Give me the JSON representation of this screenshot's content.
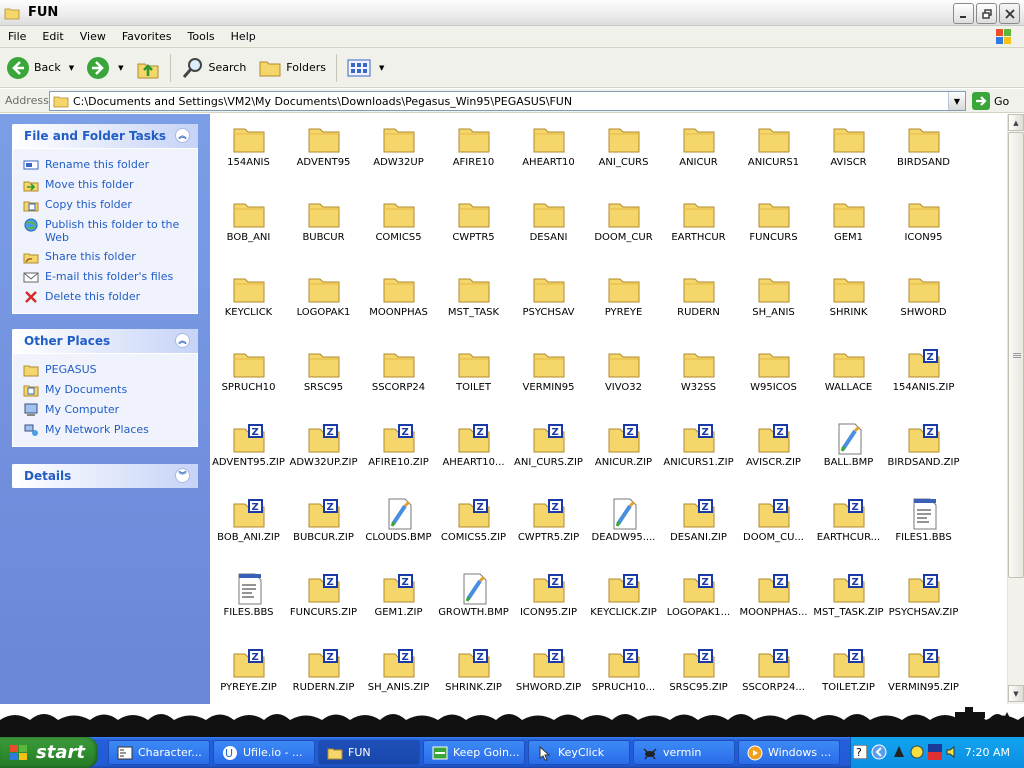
{
  "window": {
    "title": "FUN"
  },
  "menu": [
    "File",
    "Edit",
    "View",
    "Favorites",
    "Tools",
    "Help"
  ],
  "toolbar": {
    "back_label": "Back",
    "search_label": "Search",
    "folders_label": "Folders"
  },
  "address": {
    "label": "Address",
    "path": "C:\\Documents and Settings\\VM2\\My Documents\\Downloads\\Pegasus_Win95\\PEGASUS\\FUN",
    "go_label": "Go"
  },
  "tasks_panel": {
    "title": "File and Folder Tasks",
    "items": [
      {
        "label": "Rename this folder",
        "icon": "rename-icon"
      },
      {
        "label": "Move this folder",
        "icon": "move-icon"
      },
      {
        "label": "Copy this folder",
        "icon": "copy-icon"
      },
      {
        "label": "Publish this folder to the Web",
        "icon": "publish-web-icon"
      },
      {
        "label": "Share this folder",
        "icon": "share-icon"
      },
      {
        "label": "E-mail this folder's files",
        "icon": "email-icon"
      },
      {
        "label": "Delete this folder",
        "icon": "delete-icon"
      }
    ]
  },
  "places_panel": {
    "title": "Other Places",
    "items": [
      {
        "label": "PEGASUS",
        "icon": "folder-icon"
      },
      {
        "label": "My Documents",
        "icon": "my-documents-icon"
      },
      {
        "label": "My Computer",
        "icon": "my-computer-icon"
      },
      {
        "label": "My Network Places",
        "icon": "network-places-icon"
      }
    ]
  },
  "details_panel": {
    "title": "Details"
  },
  "files": [
    {
      "name": "154ANIS",
      "type": "folder"
    },
    {
      "name": "ADVENT95",
      "type": "folder"
    },
    {
      "name": "ADW32UP",
      "type": "folder"
    },
    {
      "name": "AFIRE10",
      "type": "folder"
    },
    {
      "name": "AHEART10",
      "type": "folder"
    },
    {
      "name": "ANI_CURS",
      "type": "folder"
    },
    {
      "name": "ANICUR",
      "type": "folder"
    },
    {
      "name": "ANICURS1",
      "type": "folder"
    },
    {
      "name": "AVISCR",
      "type": "folder"
    },
    {
      "name": "BIRDSAND",
      "type": "folder"
    },
    {
      "name": "BOB_ANI",
      "type": "folder"
    },
    {
      "name": "BUBCUR",
      "type": "folder"
    },
    {
      "name": "COMICS5",
      "type": "folder"
    },
    {
      "name": "CWPTR5",
      "type": "folder"
    },
    {
      "name": "DESANI",
      "type": "folder"
    },
    {
      "name": "DOOM_CUR",
      "type": "folder"
    },
    {
      "name": "EARTHCUR",
      "type": "folder"
    },
    {
      "name": "FUNCURS",
      "type": "folder"
    },
    {
      "name": "GEM1",
      "type": "folder"
    },
    {
      "name": "ICON95",
      "type": "folder"
    },
    {
      "name": "KEYCLICK",
      "type": "folder"
    },
    {
      "name": "LOGOPAK1",
      "type": "folder"
    },
    {
      "name": "MOONPHAS",
      "type": "folder"
    },
    {
      "name": "MST_TASK",
      "type": "folder"
    },
    {
      "name": "PSYCHSAV",
      "type": "folder"
    },
    {
      "name": "PYREYE",
      "type": "folder"
    },
    {
      "name": "RUDERN",
      "type": "folder"
    },
    {
      "name": "SH_ANIS",
      "type": "folder"
    },
    {
      "name": "SHRINK",
      "type": "folder"
    },
    {
      "name": "SHWORD",
      "type": "folder"
    },
    {
      "name": "SPRUCH10",
      "type": "folder"
    },
    {
      "name": "SRSC95",
      "type": "folder"
    },
    {
      "name": "SSCORP24",
      "type": "folder"
    },
    {
      "name": "TOILET",
      "type": "folder"
    },
    {
      "name": "VERMIN95",
      "type": "folder"
    },
    {
      "name": "VIVO32",
      "type": "folder"
    },
    {
      "name": "W32SS",
      "type": "folder"
    },
    {
      "name": "W95ICOS",
      "type": "folder"
    },
    {
      "name": "WALLACE",
      "type": "folder"
    },
    {
      "name": "154ANIS.ZIP",
      "type": "zip"
    },
    {
      "name": "ADVENT95.ZIP",
      "type": "zip"
    },
    {
      "name": "ADW32UP.ZIP",
      "type": "zip"
    },
    {
      "name": "AFIRE10.ZIP",
      "type": "zip"
    },
    {
      "name": "AHEART10...",
      "type": "zip"
    },
    {
      "name": "ANI_CURS.ZIP",
      "type": "zip"
    },
    {
      "name": "ANICUR.ZIP",
      "type": "zip"
    },
    {
      "name": "ANICURS1.ZIP",
      "type": "zip"
    },
    {
      "name": "AVISCR.ZIP",
      "type": "zip"
    },
    {
      "name": "BALL.BMP",
      "type": "bmp"
    },
    {
      "name": "BIRDSAND.ZIP",
      "type": "zip"
    },
    {
      "name": "BOB_ANI.ZIP",
      "type": "zip"
    },
    {
      "name": "BUBCUR.ZIP",
      "type": "zip"
    },
    {
      "name": "CLOUDS.BMP",
      "type": "bmp"
    },
    {
      "name": "COMICS5.ZIP",
      "type": "zip"
    },
    {
      "name": "CWPTR5.ZIP",
      "type": "zip"
    },
    {
      "name": "DEADW95....",
      "type": "bmp"
    },
    {
      "name": "DESANI.ZIP",
      "type": "zip"
    },
    {
      "name": "DOOM_CU...",
      "type": "zip"
    },
    {
      "name": "EARTHCUR...",
      "type": "zip"
    },
    {
      "name": "FILES1.BBS",
      "type": "bbs"
    },
    {
      "name": "FILES.BBS",
      "type": "bbs"
    },
    {
      "name": "FUNCURS.ZIP",
      "type": "zip"
    },
    {
      "name": "GEM1.ZIP",
      "type": "zip"
    },
    {
      "name": "GROWTH.BMP",
      "type": "bmp"
    },
    {
      "name": "ICON95.ZIP",
      "type": "zip"
    },
    {
      "name": "KEYCLICK.ZIP",
      "type": "zip"
    },
    {
      "name": "LOGOPAK1...",
      "type": "zip"
    },
    {
      "name": "MOONPHAS...",
      "type": "zip"
    },
    {
      "name": "MST_TASK.ZIP",
      "type": "zip"
    },
    {
      "name": "PSYCHSAV.ZIP",
      "type": "zip"
    },
    {
      "name": "PYREYE.ZIP",
      "type": "zip"
    },
    {
      "name": "RUDERN.ZIP",
      "type": "zip"
    },
    {
      "name": "SH_ANIS.ZIP",
      "type": "zip"
    },
    {
      "name": "SHRINK.ZIP",
      "type": "zip"
    },
    {
      "name": "SHWORD.ZIP",
      "type": "zip"
    },
    {
      "name": "SPRUCH10...",
      "type": "zip"
    },
    {
      "name": "SRSC95.ZIP",
      "type": "zip"
    },
    {
      "name": "SSCORP24...",
      "type": "zip"
    },
    {
      "name": "TOILET.ZIP",
      "type": "zip"
    },
    {
      "name": "VERMIN95.ZIP",
      "type": "zip"
    }
  ],
  "taskbar": {
    "start_label": "start",
    "items": [
      {
        "label": "Character...",
        "icon": "character-map-icon",
        "active": false
      },
      {
        "label": "Ufile.io - ...",
        "icon": "browser-icon",
        "active": false
      },
      {
        "label": "FUN",
        "icon": "folder-icon",
        "active": true
      },
      {
        "label": "Keep Goin...",
        "icon": "app-icon",
        "active": false
      },
      {
        "label": "KeyClick",
        "icon": "keyclick-icon",
        "active": false
      },
      {
        "label": "vermin",
        "icon": "vermin-icon",
        "active": false
      },
      {
        "label": "Windows ...",
        "icon": "media-player-icon",
        "active": false
      }
    ],
    "clock": "7:20 AM"
  },
  "colors": {
    "taskbar_blue": "#245edb",
    "start_green": "#2f8c2f",
    "panel_link_blue": "#215dc6",
    "folder_yellow": "#f5d66b"
  }
}
